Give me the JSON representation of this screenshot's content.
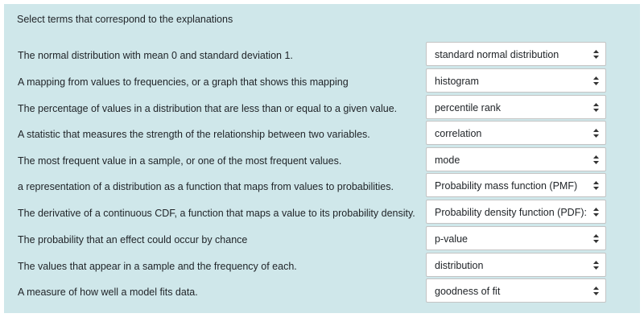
{
  "question": {
    "prompt": "Select terms that correspond to the explanations",
    "rows": [
      {
        "stem": "The normal distribution with mean 0 and standard deviation 1.",
        "selected": "standard normal distribution"
      },
      {
        "stem": "A mapping from values to frequencies, or a graph that shows this mapping",
        "selected": "histogram"
      },
      {
        "stem": "The percentage of values in a distribution that are less than or equal to a given value.",
        "selected": "percentile rank"
      },
      {
        "stem": "A statistic that measures the strength of the relationship between two variables.",
        "selected": "correlation"
      },
      {
        "stem": "The most frequent value in a sample, or one of the most frequent values.",
        "selected": "mode"
      },
      {
        "stem": "a representation of a distribution as a function that maps from values to probabilities.",
        "selected": "Probability mass function (PMF)"
      },
      {
        "stem": "The derivative of a continuous CDF, a function that maps a value to its probability density.",
        "selected": "Probability density function (PDF):"
      },
      {
        "stem": "The probability that an effect could occur by chance",
        "selected": "p-value"
      },
      {
        "stem": "The values that appear in a sample and the frequency of each.",
        "selected": "distribution"
      },
      {
        "stem": "A measure of how well a model fits data.",
        "selected": "goodness of fit"
      }
    ]
  },
  "icons": {
    "select_arrow": "up-down-caret-icon"
  },
  "colors": {
    "panel_background": "#cfe7ea",
    "select_background": "#ffffff",
    "text": "#212529"
  }
}
